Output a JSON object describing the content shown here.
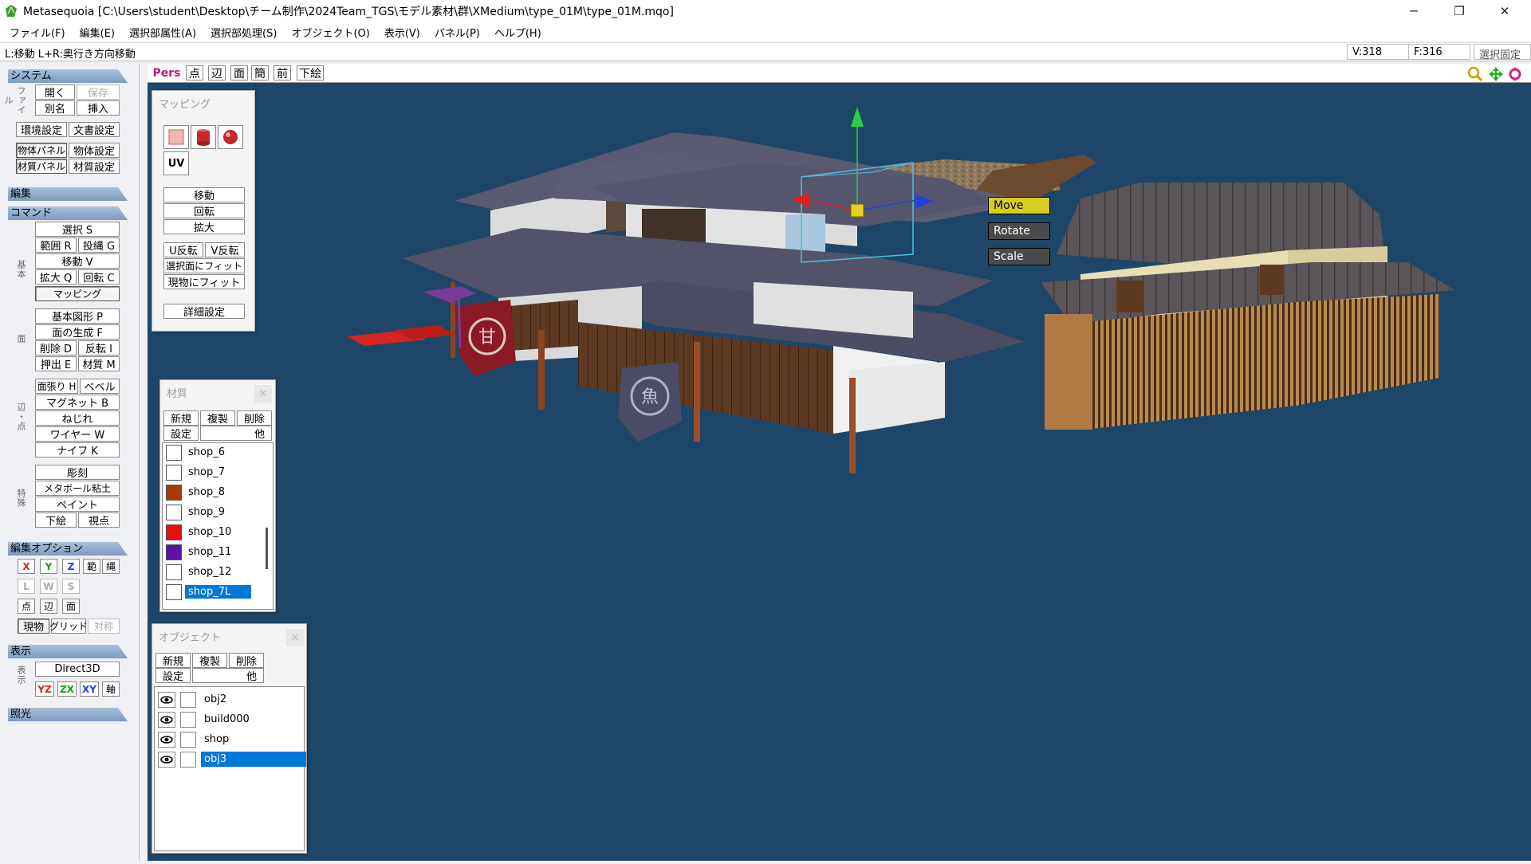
{
  "window": {
    "title": "Metasequoia [C:\\Users\\student\\Desktop\\チーム制作\\2024Team_TGS\\モデル素材\\群\\XMedium\\type_01M\\type_01M.mqo]",
    "minimize": "─",
    "restore": "❐",
    "close": "✕"
  },
  "menu": [
    "ファイル(F)",
    "編集(E)",
    "選択部属性(A)",
    "選択部処理(S)",
    "オブジェクト(O)",
    "表示(V)",
    "パネル(P)",
    "ヘルプ(H)"
  ],
  "status": {
    "hint": "L:移動  L+R:奥行き方向移動",
    "vertices": "V:318",
    "faces": "F:316",
    "select_lock": "選択固定"
  },
  "left": {
    "system": {
      "header": "システム",
      "file_label": "ファイル",
      "open": "開く",
      "save": "保存",
      "save_as": "別名",
      "insert": "挿入",
      "env": "環境設定",
      "doc": "文書設定",
      "obj_panel": "物体パネル",
      "obj_settings": "物体設定",
      "mat_panel": "材質パネル",
      "mat_settings": "材質設定"
    },
    "edit": {
      "header": "編集"
    },
    "command": {
      "header": "コマンド",
      "basic_label": "基本",
      "select": "選択 S",
      "range": "範囲 R",
      "lasso": "投縄 G",
      "move": "移動 V",
      "scale": "拡大 Q",
      "rotate": "回転 C",
      "mapping": "マッピング",
      "face_label": "面",
      "primitive": "基本図形 P",
      "create_face": "面の生成 F",
      "delete": "削除 D",
      "invert": "反転 I",
      "extrude": "押出 E",
      "material": "材質 M",
      "edge_label": "辺・点",
      "stretch": "面張り H",
      "bevel": "ベベル",
      "magnet": "マグネット B",
      "twist": "ねじれ",
      "wire": "ワイヤー W",
      "knife": "ナイフ K",
      "special_label": "特殊",
      "sculpt": "彫刻",
      "metaball": "メタボール粘土",
      "paint": "ペイント",
      "underlay": "下絵",
      "viewpoint": "視点"
    },
    "edit_options": {
      "header": "編集オプション",
      "x": "X",
      "y": "Y",
      "z": "Z",
      "range": "範",
      "rope": "縄",
      "l": "L",
      "w": "W",
      "s": "S",
      "pt": "点",
      "edge": "辺",
      "face": "面",
      "current": "現物",
      "grid": "グリッド",
      "symmetry": "対称"
    },
    "display": {
      "header": "表示",
      "label": "表示",
      "direct3d": "Direct3D",
      "yz": "YZ",
      "zx": "ZX",
      "xy": "XY",
      "axis": "軸"
    },
    "lighting": {
      "header": "照光"
    }
  },
  "viewport_toolbar": {
    "pers": "Pers",
    "pt": "点",
    "edge": "辺",
    "face": "面",
    "simple": "簡",
    "front": "前",
    "underlay": "下絵"
  },
  "mapping_panel": {
    "title": "マッピング",
    "uv": "UV",
    "move": "移動",
    "rotate": "回転",
    "scale": "拡大",
    "u_flip": "U反転",
    "v_flip": "V反転",
    "fit_selected": "選択面にフィット",
    "fit_object": "現物にフィット",
    "details": "詳細設定"
  },
  "material_panel": {
    "title": "材質",
    "new": "新規",
    "copy": "複製",
    "delete": "削除",
    "settings": "設定",
    "other": "他",
    "items": [
      {
        "name": "shop_6",
        "color": "#ffffff"
      },
      {
        "name": "shop_7",
        "color": "#ffffff"
      },
      {
        "name": "shop_8",
        "color": "#a53b0a"
      },
      {
        "name": "shop_9",
        "color": "#ffffff"
      },
      {
        "name": "shop_10",
        "color": "#e81010"
      },
      {
        "name": "shop_11",
        "color": "#5a14a6"
      },
      {
        "name": "shop_12",
        "color": "#ffffff"
      },
      {
        "name": "shop_7L",
        "color": "#ffffff"
      }
    ],
    "selected": "shop_7L"
  },
  "object_panel": {
    "title": "オブジェクト",
    "new": "新規",
    "copy": "複製",
    "delete": "削除",
    "settings": "設定",
    "other": "他",
    "items": [
      "obj2",
      "build000",
      "shop",
      "obj3"
    ],
    "selected": "obj3"
  },
  "gizmo": {
    "move": "Move",
    "rotate": "Rotate",
    "scale": "Scale"
  },
  "banners": {
    "sweet": "甘",
    "fish": "魚"
  }
}
